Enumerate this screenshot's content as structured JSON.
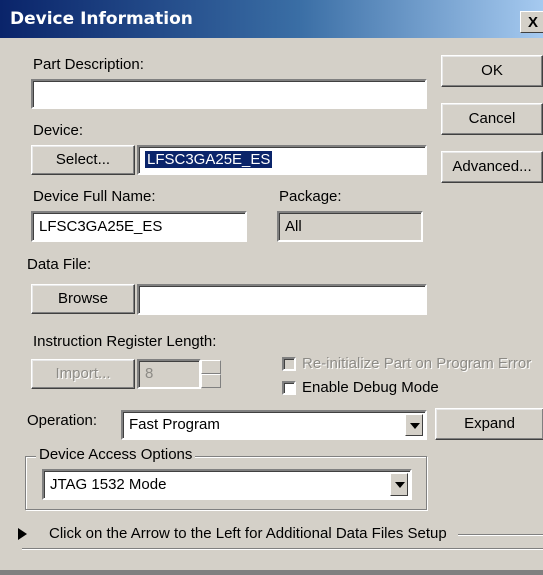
{
  "window": {
    "title": "Device Information",
    "close_label": "X"
  },
  "part_description": {
    "label": "Part Description:",
    "value": ""
  },
  "device": {
    "label": "Device:",
    "select_label": "Select...",
    "value": "LFSC3GA25E_ES"
  },
  "device_full_name": {
    "label": "Device Full Name:",
    "value": "LFSC3GA25E_ES"
  },
  "package": {
    "label": "Package:",
    "value": "All"
  },
  "data_file": {
    "label": "Data File:",
    "browse_label": "Browse",
    "value": ""
  },
  "instruction_register": {
    "label": "Instruction Register Length:",
    "import_label": "Import...",
    "value": "8"
  },
  "options": {
    "reinitialize_label": "Re-initialize Part on Program Error",
    "reinitialize_checked": false,
    "debug_label": "Enable Debug Mode",
    "debug_checked": false
  },
  "operation": {
    "label": "Operation:",
    "value": "Fast Program",
    "expand_label": "Expand"
  },
  "device_access": {
    "title": "Device Access Options",
    "value": "JTAG 1532 Mode"
  },
  "additional": {
    "text": "Click on the Arrow to the Left for Additional Data Files Setup"
  },
  "buttons": {
    "ok": "OK",
    "cancel": "Cancel",
    "advanced": "Advanced..."
  }
}
